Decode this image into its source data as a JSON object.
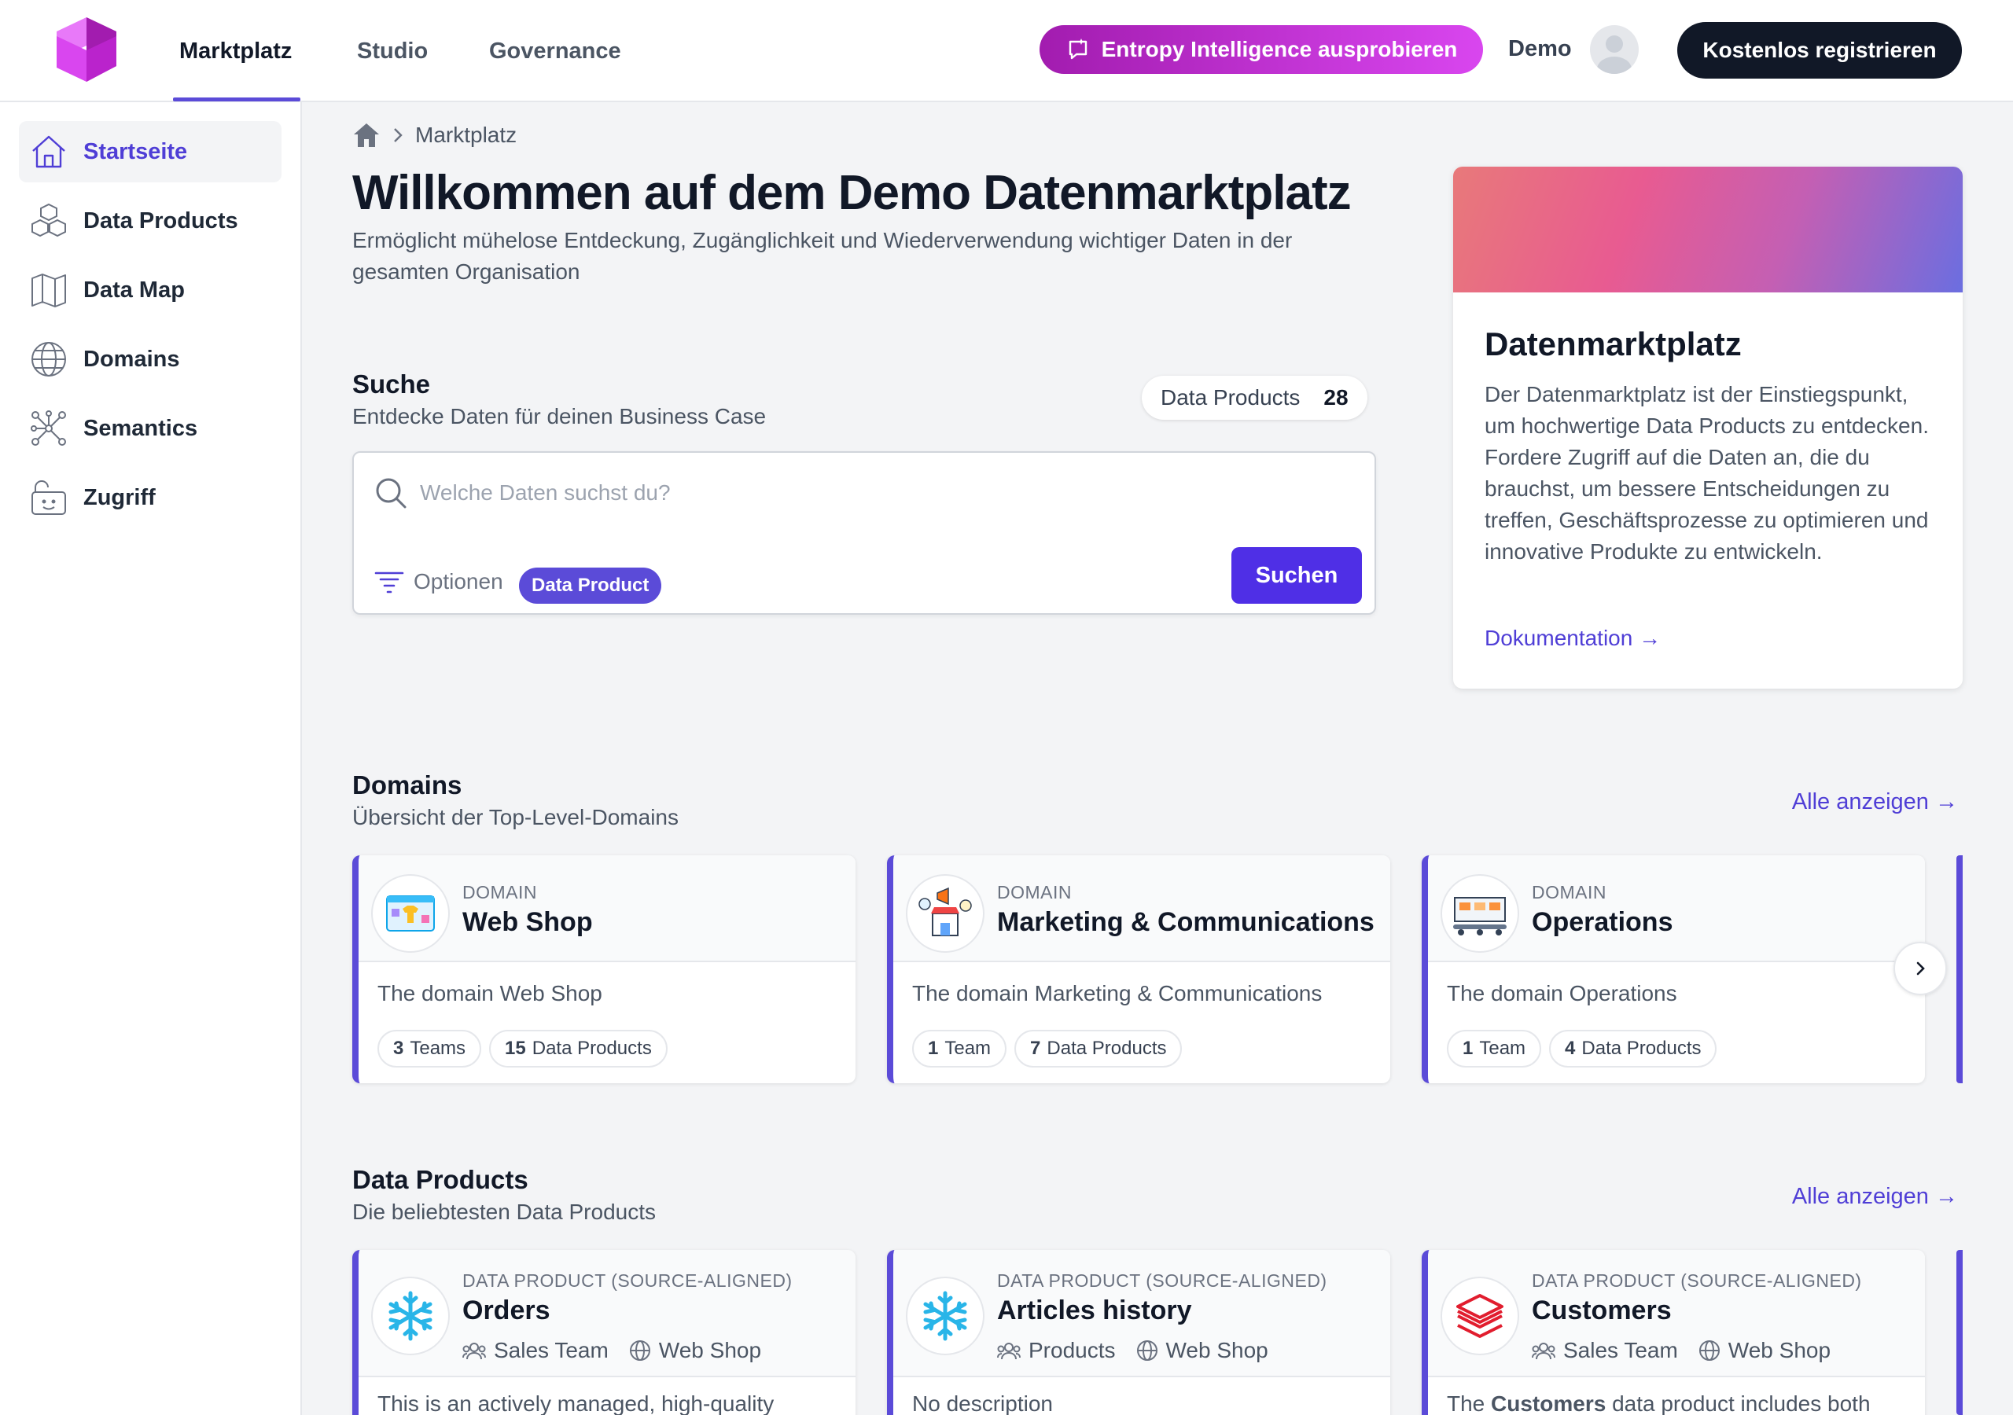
{
  "topnav": {
    "tabs": [
      "Marktplatz",
      "Studio",
      "Governance"
    ],
    "entropy_button": "Entropy Intelligence ausprobieren",
    "user_label": "Demo",
    "register_button": "Kostenlos registrieren"
  },
  "sidebar": {
    "items": [
      {
        "label": "Startseite",
        "icon": "home-icon"
      },
      {
        "label": "Data Products",
        "icon": "cubes-icon"
      },
      {
        "label": "Data Map",
        "icon": "map-icon"
      },
      {
        "label": "Domains",
        "icon": "globe-icon"
      },
      {
        "label": "Semantics",
        "icon": "graph-icon"
      },
      {
        "label": "Zugriff",
        "icon": "access-icon"
      }
    ]
  },
  "breadcrumb": {
    "current": "Marktplatz"
  },
  "page": {
    "title": "Willkommen auf dem Demo Datenmarktplatz",
    "subtitle": "Ermöglicht mühelose Entdeckung, Zugänglichkeit und Wiederverwendung wichtiger Daten in der gesamten Organisation"
  },
  "search": {
    "title": "Suche",
    "subtitle": "Entdecke Daten für deinen Business Case",
    "count_label": "Data Products",
    "count_value": "28",
    "placeholder": "Welche Daten suchst du?",
    "options_label": "Optionen",
    "filter_tag": "Data Product",
    "button": "Suchen"
  },
  "info_card": {
    "title": "Datenmarktplatz",
    "text": "Der Datenmarktplatz ist der Einstiegspunkt, um hochwertige Data Products zu entdecken. Fordere Zugriff auf die Daten an, die du brauchst, um bessere Entscheidungen zu treffen, Geschäftsprozesse zu optimieren und innovative Produkte zu entwickeln.",
    "link": "Dokumentation →"
  },
  "domains": {
    "title": "Domains",
    "subtitle": "Übersicht der Top-Level-Domains",
    "show_all": "Alle anzeigen →",
    "cards": [
      {
        "type": "DOMAIN",
        "name": "Web Shop",
        "desc": "The domain Web Shop",
        "teams": "3",
        "teams_label": "Teams",
        "products": "15",
        "products_label": "Data Products"
      },
      {
        "type": "DOMAIN",
        "name": "Marketing & Communications",
        "desc": "The domain Marketing & Communications",
        "teams": "1",
        "teams_label": "Team",
        "products": "7",
        "products_label": "Data Products"
      },
      {
        "type": "DOMAIN",
        "name": "Operations",
        "desc": "The domain Operations",
        "teams": "1",
        "teams_label": "Team",
        "products": "4",
        "products_label": "Data Products"
      }
    ]
  },
  "data_products": {
    "title": "Data Products",
    "subtitle": "Die beliebtesten Data Products",
    "show_all": "Alle anzeigen →",
    "cards": [
      {
        "type": "DATA PRODUCT (SOURCE-ALIGNED)",
        "name": "Orders",
        "team": "Sales Team",
        "domain": "Web Shop",
        "desc": "This is an actively managed, high-quality"
      },
      {
        "type": "DATA PRODUCT (SOURCE-ALIGNED)",
        "name": "Articles history",
        "team": "Products",
        "domain": "Web Shop",
        "desc": "No description"
      },
      {
        "type": "DATA PRODUCT (SOURCE-ALIGNED)",
        "name": "Customers",
        "team": "Sales Team",
        "domain": "Web Shop",
        "desc_prefix": "The ",
        "desc_bold": "Customers",
        "desc_suffix": " data product includes both"
      }
    ]
  },
  "colors": {
    "accent": "#5b4bd8",
    "primary_button": "#4f2fe6",
    "entropy": "#c026d3",
    "dark": "#111827"
  }
}
